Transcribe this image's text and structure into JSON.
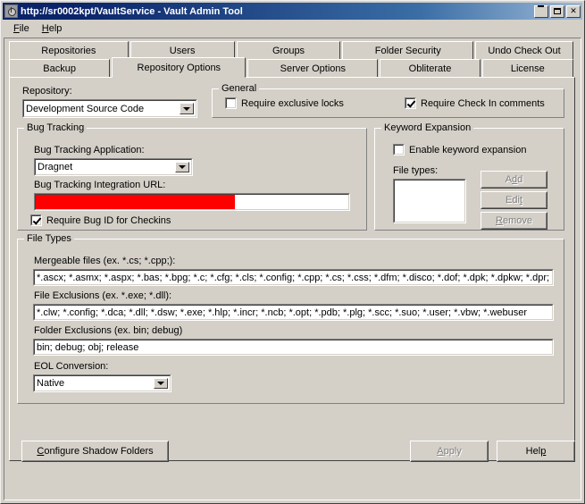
{
  "window": {
    "title": "http://sr0002kpt/VaultService - Vault Admin Tool",
    "icon": "vault-app-icon",
    "minimize_label": "_",
    "maximize_label": "□",
    "close_label": "✕"
  },
  "menubar": {
    "items": [
      {
        "label": "File",
        "accel": "F"
      },
      {
        "label": "Help",
        "accel": "H"
      }
    ]
  },
  "tabs": {
    "row1": [
      {
        "label": "Repositories",
        "active": false
      },
      {
        "label": "Users",
        "active": false
      },
      {
        "label": "Groups",
        "active": false
      },
      {
        "label": "Folder Security",
        "active": false
      },
      {
        "label": "Undo Check Out",
        "active": false
      }
    ],
    "row2": [
      {
        "label": "Backup",
        "active": false
      },
      {
        "label": "Repository Options",
        "active": true
      },
      {
        "label": "Server Options",
        "active": false
      },
      {
        "label": "Obliterate",
        "active": false
      },
      {
        "label": "License",
        "active": false
      }
    ]
  },
  "repository": {
    "label": "Repository:",
    "selected": "Development Source Code"
  },
  "general": {
    "title": "General",
    "require_exclusive_locks": {
      "label": "Require exclusive locks",
      "checked": false
    },
    "require_checkin_comments": {
      "label": "Require Check In comments",
      "checked": true
    }
  },
  "bug_tracking": {
    "title": "Bug Tracking",
    "application_label": "Bug Tracking Application:",
    "application_value": "Dragnet",
    "url_label": "Bug Tracking Integration URL:",
    "url_value": "",
    "url_selection_color": "#ff0000",
    "require_bug_id": {
      "label": "Require Bug ID for Checkins",
      "checked": true
    }
  },
  "keyword_expansion": {
    "title": "Keyword Expansion",
    "enable": {
      "label": "Enable keyword expansion",
      "checked": false
    },
    "file_types_label": "File types:",
    "file_types_items": [],
    "buttons": [
      {
        "label": "Add",
        "accel": "d",
        "disabled": true
      },
      {
        "label": "Edit",
        "accel": "t",
        "disabled": true
      },
      {
        "label": "Remove",
        "accel": "R",
        "disabled": true
      }
    ]
  },
  "file_types": {
    "title": "File Types",
    "mergeable_label": "Mergeable files (ex. *.cs; *.cpp;):",
    "mergeable_value": "*.ascx; *.asmx; *.aspx; *.bas; *.bpg; *.c; *.cfg; *.cls; *.config; *.cpp; *.cs; *.css; *.dfm; *.disco; *.dof; *.dpk; *.dpkw; *.dpr; *.dsk;",
    "file_exclusions_label": "File Exclusions (ex. *.exe; *.dll):",
    "file_exclusions_value": "*.clw; *.config; *.dca; *.dll; *.dsw; *.exe; *.hlp; *.incr; *.ncb; *.opt; *.pdb; *.plg; *.scc; *.suo; *.user; *.vbw; *.webuser",
    "folder_exclusions_label": "Folder Exclusions (ex. bin; debug)",
    "folder_exclusions_value": "bin; debug; obj; release",
    "eol_label": "EOL Conversion:",
    "eol_value": "Native"
  },
  "footer": {
    "configure_shadow_folders": {
      "label": "Configure Shadow Folders",
      "accel": "C",
      "disabled": false
    },
    "apply": {
      "label": "Apply",
      "accel": "A",
      "disabled": true
    },
    "help": {
      "label": "Help",
      "accel": "p",
      "disabled": false
    }
  }
}
